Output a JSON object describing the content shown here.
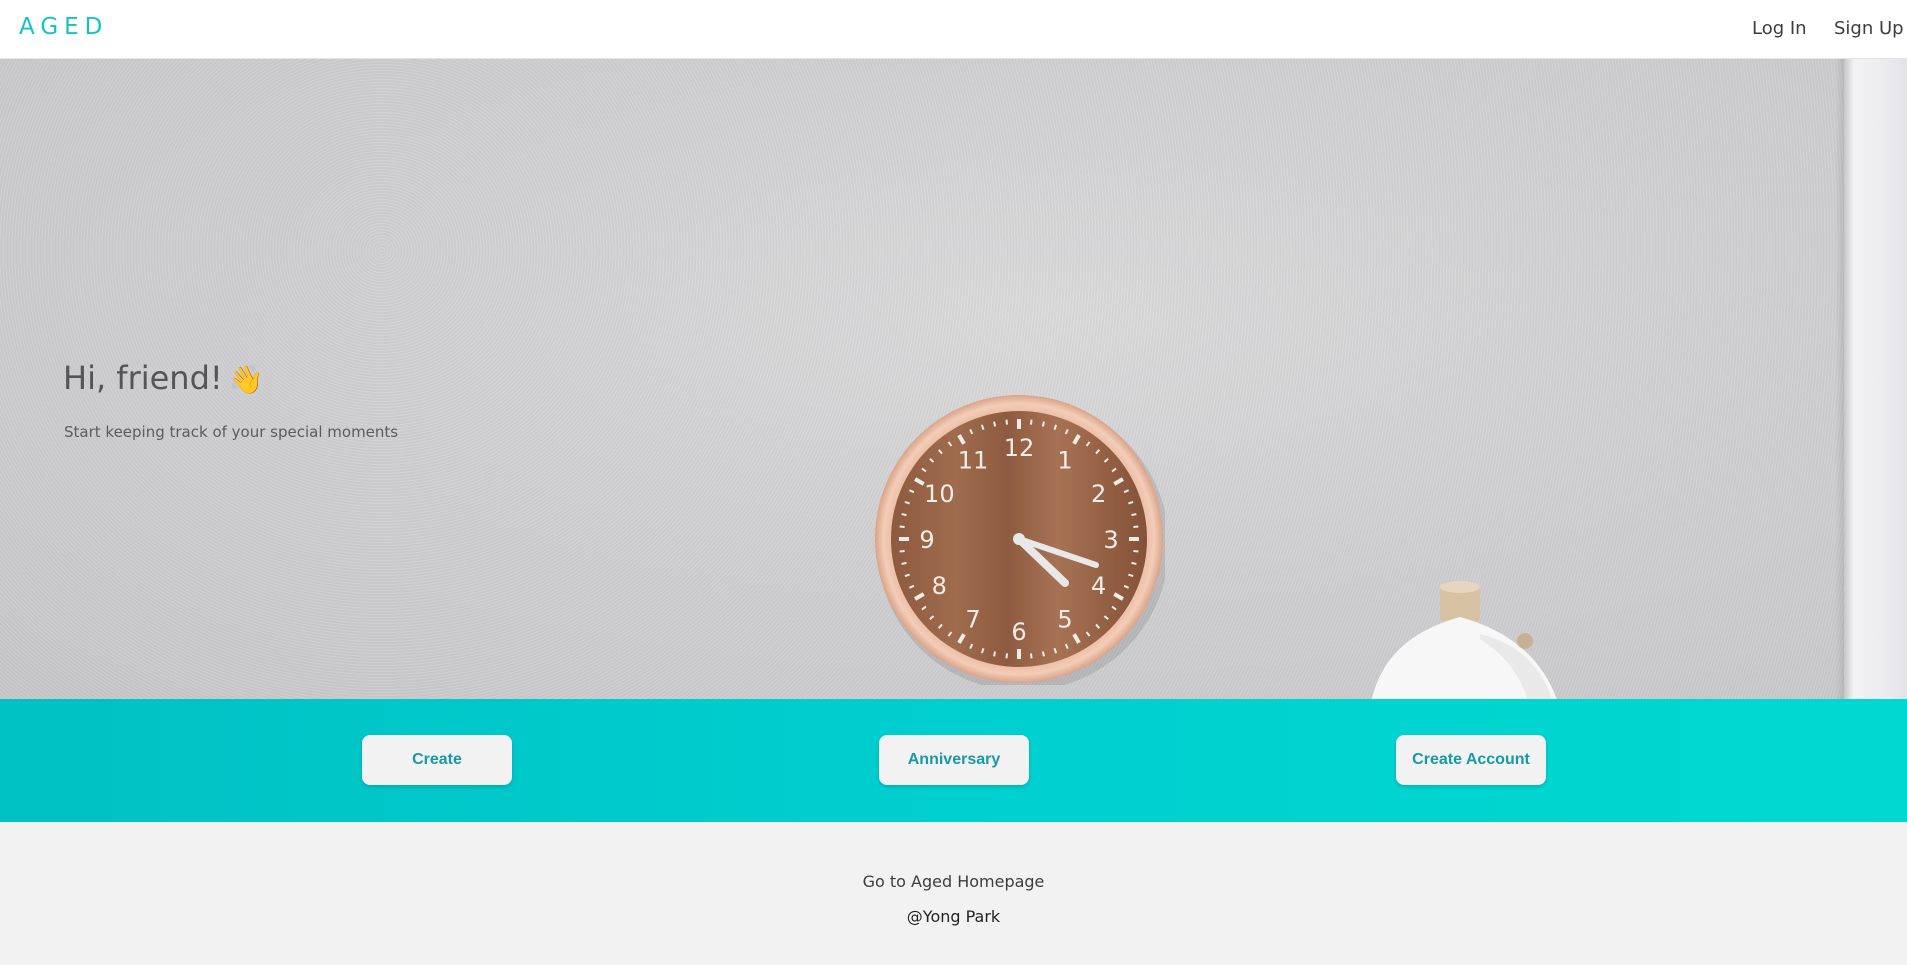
{
  "navbar": {
    "brand": "AGED",
    "login_label": "Log In",
    "signup_label": "Sign Up",
    "brand_color": "#16c3c3"
  },
  "hero": {
    "title": "Hi, friend!",
    "wave_emoji": "👋",
    "subtitle": "Start keeping track of your special moments",
    "background_image": "wall-clock-photo"
  },
  "clock": {
    "numbers": [
      "12",
      "1",
      "2",
      "3",
      "4",
      "5",
      "6",
      "7",
      "8",
      "9",
      "10",
      "11"
    ]
  },
  "actions": {
    "create_label": "Create",
    "anniversary_label": "Anniversary",
    "create_account_label": "Create Account",
    "bar_color": "#00cccc",
    "button_text_color": "#169aa6"
  },
  "footer": {
    "homepage_link": "Go to Aged Homepage",
    "credit": "@Yong Park"
  }
}
